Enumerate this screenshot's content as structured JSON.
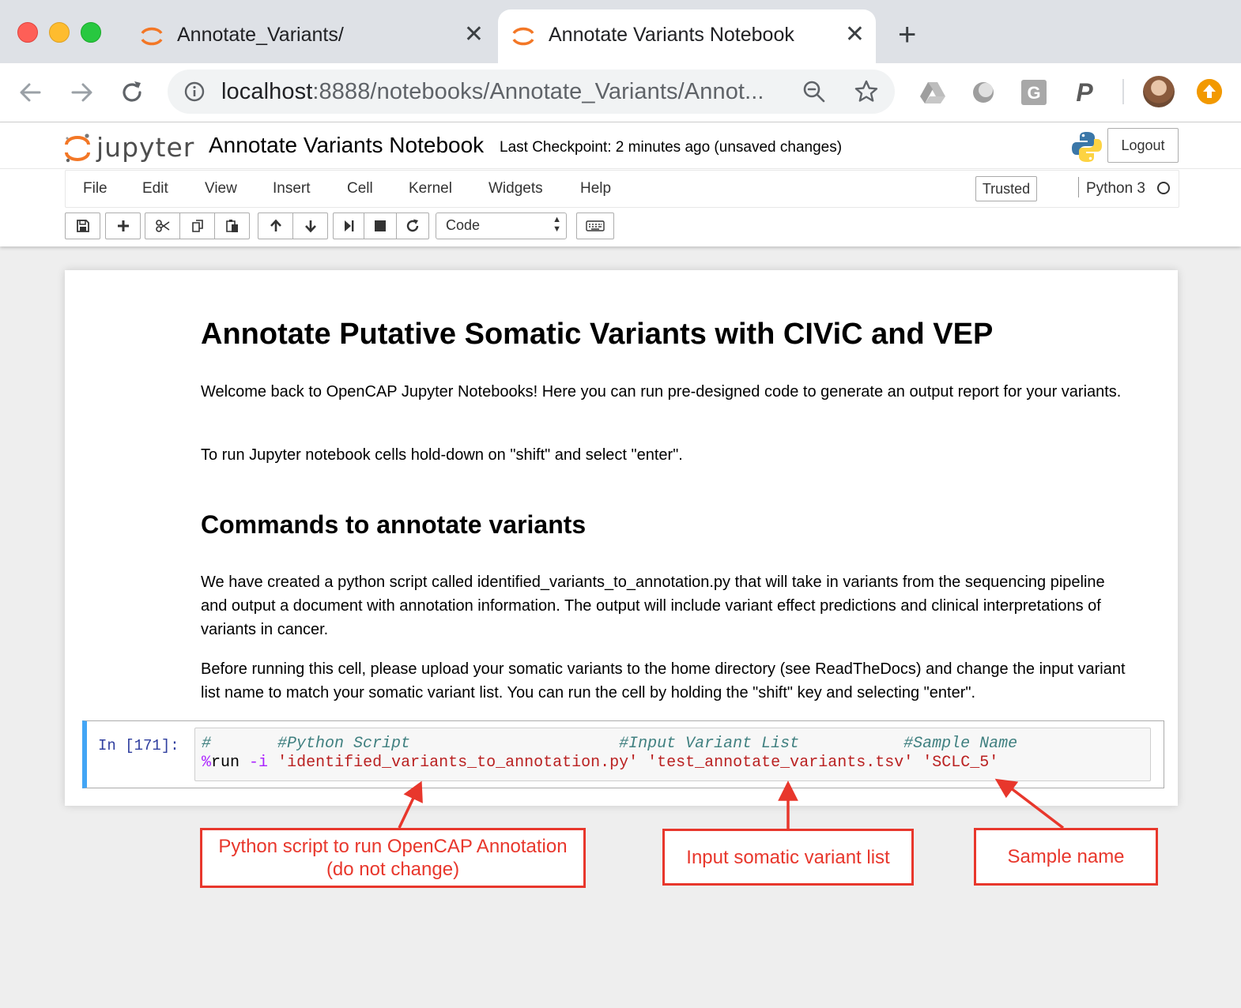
{
  "browser": {
    "tabs": [
      {
        "title": "Annotate_Variants/",
        "active": false
      },
      {
        "title": "Annotate Variants Notebook",
        "active": true
      }
    ],
    "url_host": "localhost",
    "url_path": ":8888/notebooks/Annotate_Variants/Annot...",
    "extensions": [
      "google-drive-icon",
      "extension-circle-icon",
      "grammarly-icon",
      "paypal-icon"
    ],
    "colors": {
      "tabstrip": "#dee1e6",
      "update_badge": "#f29900"
    }
  },
  "jupyter": {
    "logo_text": "jupyter",
    "notebook_name": "Annotate Variants Notebook",
    "checkpoint": "Last Checkpoint: 2 minutes ago (unsaved changes)",
    "logout_label": "Logout",
    "menu": [
      "File",
      "Edit",
      "View",
      "Insert",
      "Cell",
      "Kernel",
      "Widgets",
      "Help"
    ],
    "trusted_label": "Trusted",
    "kernel_name": "Python 3",
    "cell_type": "Code",
    "toolbar_icons": [
      "save-icon",
      "add-icon",
      "cut-icon",
      "copy-icon",
      "paste-icon",
      "move-up-icon",
      "move-down-icon",
      "run-icon",
      "stop-icon",
      "restart-icon",
      "keyboard-icon"
    ]
  },
  "notebook": {
    "heading1": "Annotate Putative Somatic Variants with CIViC and VEP",
    "para1": "Welcome back to OpenCAP Jupyter Notebooks! Here you can run pre-designed code to generate an output report for your variants.",
    "para2": "To run Jupyter notebook cells hold-down on \"shift\" and select \"enter\".",
    "heading2": "Commands to annotate variants",
    "para3": "We have created a python script called identified_variants_to_annotation.py that will take in variants from the sequencing pipeline and output a document with annotation information. The output will include variant effect predictions and clinical interpretations of variants in cancer.",
    "para4": "Before running this cell, please upload your somatic variants to the home directory (see ReadTheDocs) and change the input variant list name to match your somatic variant list. You can run the cell by holding the \"shift\" key and selecting \"enter\".",
    "cell": {
      "prompt": "In [171]:",
      "line1": {
        "c1": "#       ",
        "c2": "#Python Script                      ",
        "c3": "#Input Variant List           ",
        "c4": "#Sample Name"
      },
      "line2": {
        "magic": "%",
        "cmd": "run ",
        "flag": "-i",
        "script": "'identified_variants_to_annotation.py'",
        "input": "'test_annotate_variants.tsv'",
        "sample": "'SCLC_5'"
      }
    }
  },
  "annotations": {
    "box1": "Python script to run OpenCAP Annotation (do not change)",
    "box2": "Input somatic variant list",
    "box3": "Sample name",
    "color": "#e8372c"
  }
}
